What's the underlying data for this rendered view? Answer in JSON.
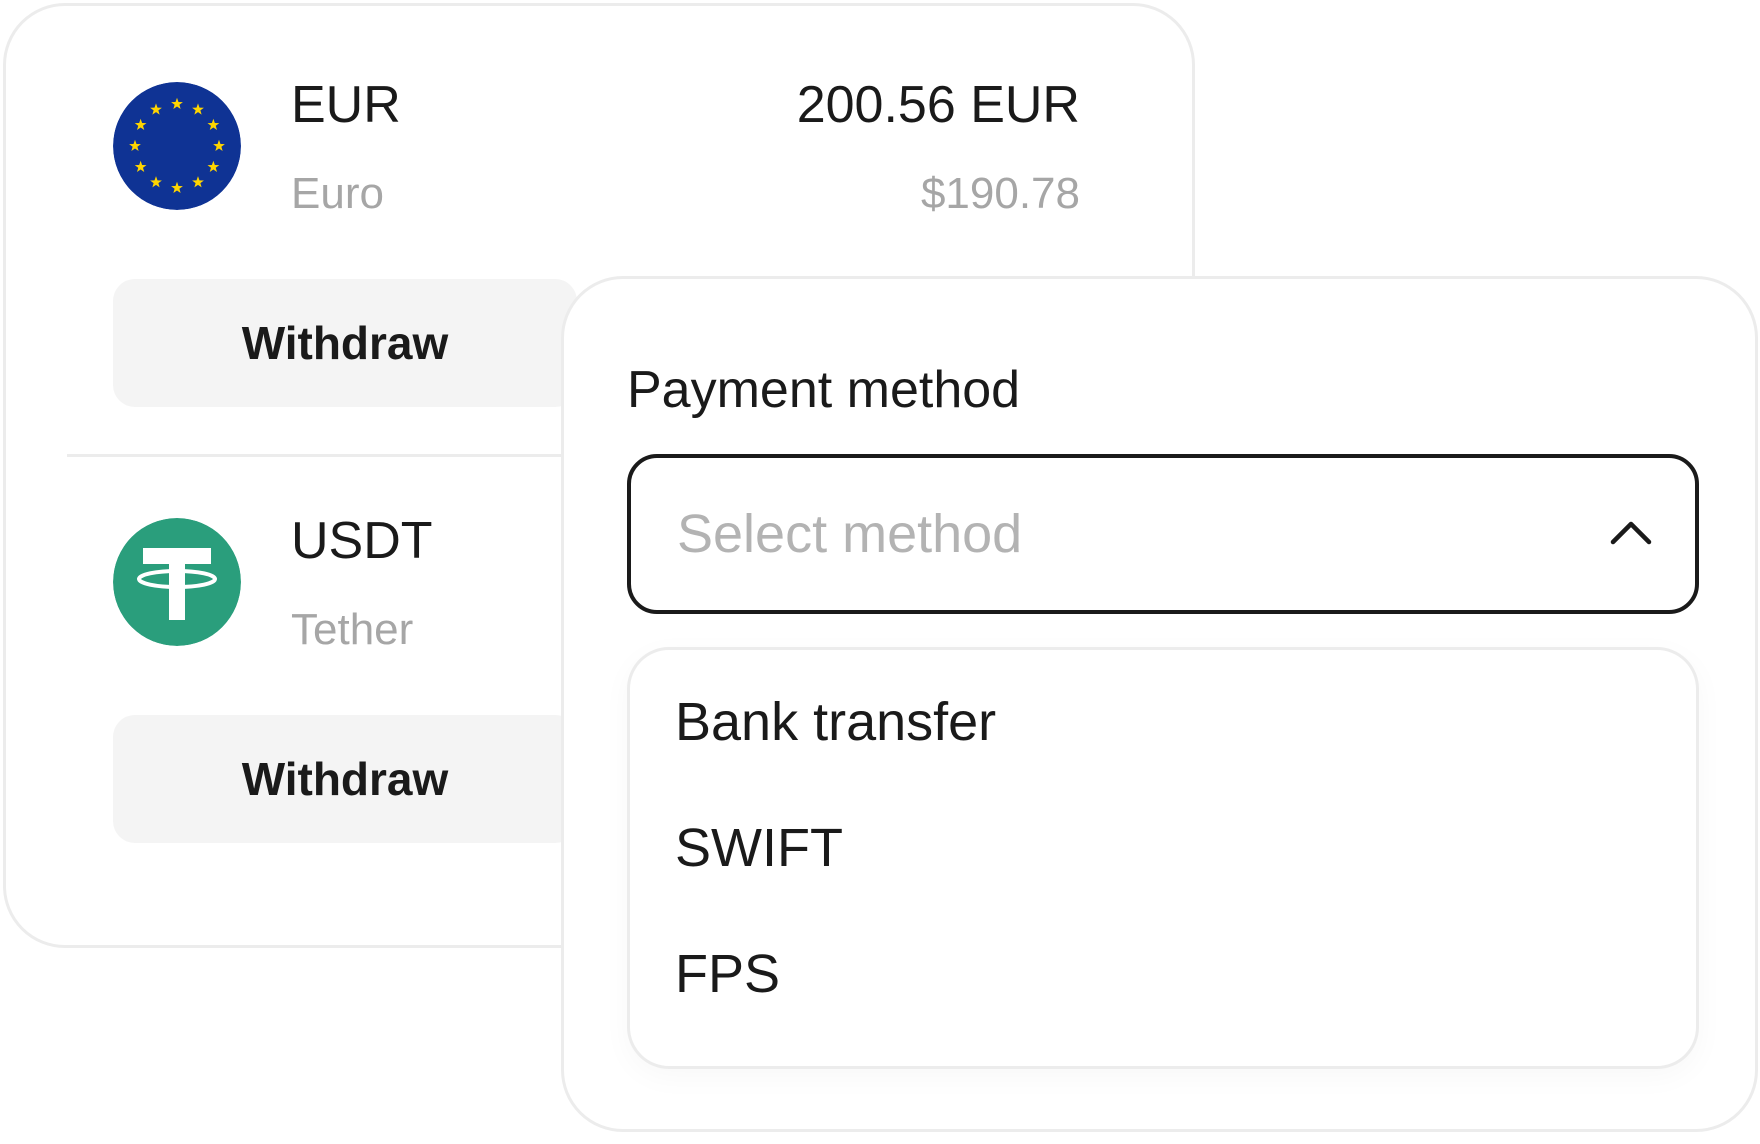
{
  "assets": [
    {
      "code": "EUR",
      "name": "Euro",
      "amount": "200.56 EUR",
      "fiat_value": "$190.78",
      "icon": "eu-flag-icon",
      "withdraw_label": "Withdraw"
    },
    {
      "code": "USDT",
      "name": "Tether",
      "icon": "tether-icon",
      "withdraw_label": "Withdraw"
    }
  ],
  "payment": {
    "label": "Payment method",
    "placeholder": "Select method",
    "expanded": true,
    "options": [
      "Bank transfer",
      "SWIFT",
      "FPS"
    ]
  },
  "colors": {
    "eu_blue": "#0f3394",
    "eu_star": "#ffd500",
    "tether_green": "#2a9e7c",
    "text_primary": "#1a1a1a",
    "text_secondary": "#a6a6a6",
    "button_bg": "#f4f4f4",
    "border": "#ececec"
  }
}
